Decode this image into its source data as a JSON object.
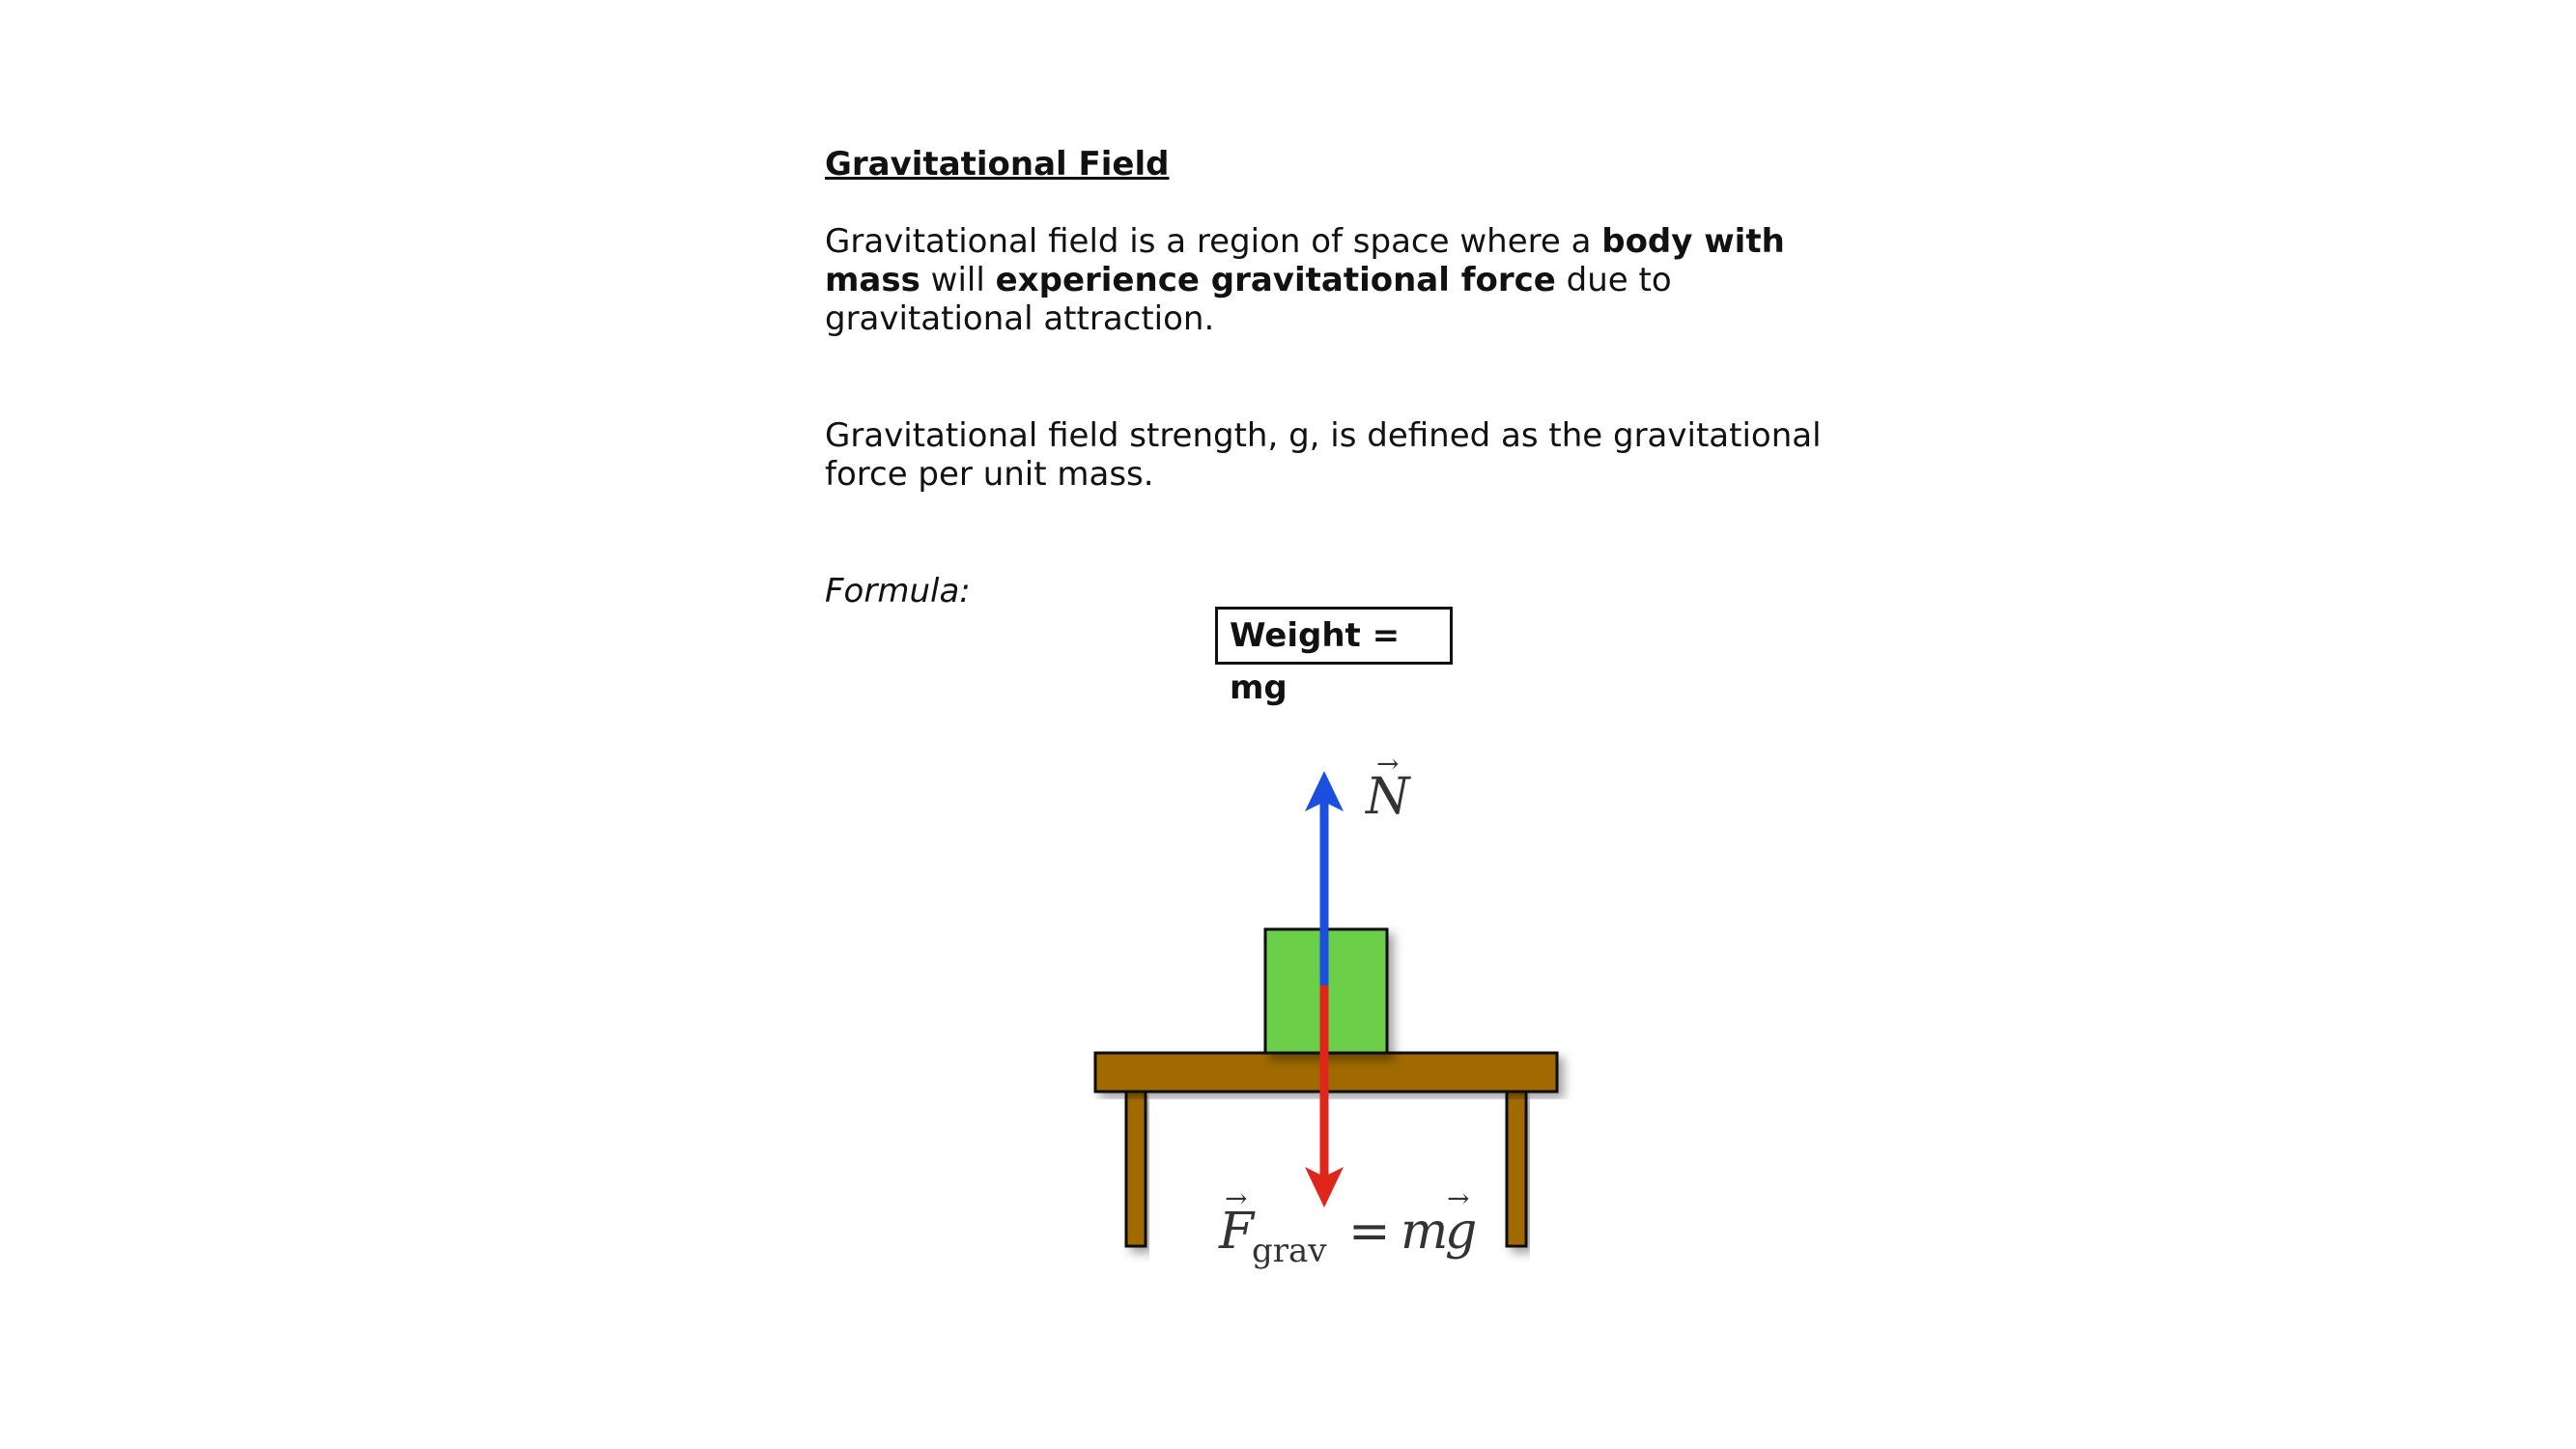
{
  "slide": {
    "heading": "Gravitational Field",
    "para1": {
      "t1": "Gravitational field is a region of space where a ",
      "b1": "body with mass",
      "t2": " will ",
      "b2": "experience gravitational force",
      "t3": " due to gravitational attraction."
    },
    "para2": "Gravitational field strength, g, is defined as the gravitational force per unit mass.",
    "formula_label": "Formula:",
    "formula": "Weight = mg"
  },
  "diagram": {
    "normal_force_label": "N",
    "gravity_label_main": "F",
    "gravity_label_sub": "grav",
    "gravity_label_rhs_eq": "=",
    "gravity_label_rhs_m": "m",
    "gravity_label_rhs_g": "g",
    "vector_arrow": "→",
    "colors": {
      "block": "#6ccf4a",
      "table": "#a06a00",
      "normal_arrow": "#1a4fe0",
      "gravity_arrow": "#e0251a"
    }
  }
}
